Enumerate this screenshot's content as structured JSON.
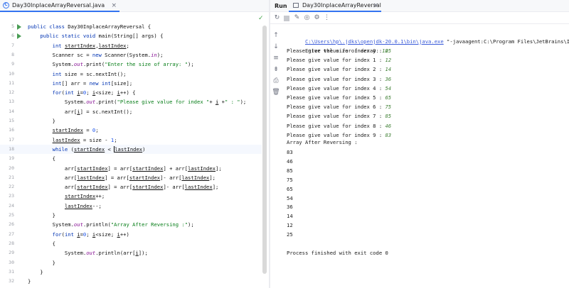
{
  "editor": {
    "tab_label": "Day30InplaceArrayReversal.java",
    "tab_close": "×",
    "check": "✓",
    "lines": [
      {
        "no": "5",
        "runnable": true,
        "html": "<span class=\"kw\">public class</span> Day30InplaceArrayReversal {"
      },
      {
        "no": "6",
        "runnable": true,
        "html": "    <span class=\"kw\">public static void</span> main(String[] args) {"
      },
      {
        "no": "7",
        "runnable": false,
        "html": "        <span class=\"kw\">int</span> <span class=\"ul\">startIndex</span>,<span class=\"ul\">lastIndex</span>;"
      },
      {
        "no": "8",
        "runnable": false,
        "html": "        Scanner sc = <span class=\"kw\">new</span> Scanner(System.<span class=\"st\">in</span>);"
      },
      {
        "no": "9",
        "runnable": false,
        "html": "        System.<span class=\"st\">out</span>.print(<span class=\"str\">\"Enter the size of array: \"</span>);"
      },
      {
        "no": "10",
        "runnable": false,
        "html": "        <span class=\"kw\">int</span> size = sc.nextInt();"
      },
      {
        "no": "11",
        "runnable": false,
        "html": "        <span class=\"kw\">int</span>[] arr = <span class=\"kw\">new int</span>[size];"
      },
      {
        "no": "12",
        "runnable": false,
        "html": "        <span class=\"kw\">for</span>(<span class=\"kw\">int</span> <span class=\"ul\">i</span>=<span class=\"num\">0</span>; <span class=\"ul\">i</span>&lt;size; <span class=\"ul\">i</span>++) {"
      },
      {
        "no": "13",
        "runnable": false,
        "html": "            System.<span class=\"st\">out</span>.print(<span class=\"str\">\"Please give value for index \"</span>+ <span class=\"ul\">i</span> +<span class=\"str\">\" : \"</span>);"
      },
      {
        "no": "14",
        "runnable": false,
        "html": "            arr[<span class=\"ul\">i</span>] = sc.nextInt();"
      },
      {
        "no": "15",
        "runnable": false,
        "html": "        }"
      },
      {
        "no": "16",
        "runnable": false,
        "html": "        <span class=\"ul\">startIndex</span> = <span class=\"num\">0</span>;"
      },
      {
        "no": "17",
        "runnable": false,
        "html": "        <span class=\"ul\">lastIndex</span> = size - <span class=\"num\">1</span>;"
      },
      {
        "no": "18",
        "runnable": false,
        "current": true,
        "html": "        <span class=\"kw\">while</span> (<span class=\"ul\">startIndex</span> &lt; <span class=\"ul cursor\">lastIndex</span>)"
      },
      {
        "no": "19",
        "runnable": false,
        "html": "        {"
      },
      {
        "no": "20",
        "runnable": false,
        "html": "            arr[<span class=\"ul\">startIndex</span>] = arr[<span class=\"ul\">startIndex</span>] + arr[<span class=\"ul\">lastIndex</span>];"
      },
      {
        "no": "21",
        "runnable": false,
        "html": "            arr[<span class=\"ul\">lastIndex</span>] = arr[<span class=\"ul\">startIndex</span>]- arr[<span class=\"ul\">lastIndex</span>];"
      },
      {
        "no": "22",
        "runnable": false,
        "html": "            arr[<span class=\"ul\">startIndex</span>] = arr[<span class=\"ul\">startIndex</span>]- arr[<span class=\"ul\">lastIndex</span>];"
      },
      {
        "no": "23",
        "runnable": false,
        "html": "            <span class=\"ul\">startIndex</span>++;"
      },
      {
        "no": "24",
        "runnable": false,
        "html": "            <span class=\"ul\">lastIndex</span>--;"
      },
      {
        "no": "25",
        "runnable": false,
        "html": "        }"
      },
      {
        "no": "26",
        "runnable": false,
        "html": "        System.<span class=\"st\">out</span>.println(<span class=\"str\">\"Array After Reversing :\"</span>);"
      },
      {
        "no": "27",
        "runnable": false,
        "html": "        <span class=\"kw\">for</span>(<span class=\"kw\">int</span> <span class=\"ul\">i</span>=<span class=\"num\">0</span>; <span class=\"ul\">i</span>&lt;size; <span class=\"ul\">i</span>++)"
      },
      {
        "no": "28",
        "runnable": false,
        "html": "        {"
      },
      {
        "no": "29",
        "runnable": false,
        "html": "            System.<span class=\"st\">out</span>.println(arr[<span class=\"ul\">i</span>]);"
      },
      {
        "no": "30",
        "runnable": false,
        "html": "        }"
      },
      {
        "no": "31",
        "runnable": false,
        "html": "    }"
      },
      {
        "no": "32",
        "runnable": false,
        "html": "}"
      },
      {
        "no": "33",
        "runnable": false,
        "html": ""
      }
    ]
  },
  "run": {
    "title": "Run",
    "tab_label": "Day30InplaceArrayReversal",
    "tab_close": "×",
    "toolbar_icons": [
      "rerun-icon",
      "stop-icon",
      "debug-icon",
      "camera-icon",
      "settings-icon",
      "more-icon"
    ],
    "toolbar_glyphs": [
      "↻",
      "",
      "✎",
      "◎",
      "⚙",
      "⋮"
    ],
    "side_glyphs": [
      "↑",
      "↓",
      "≡",
      "⇟",
      "⎙",
      "🗑"
    ],
    "side_names": [
      "scroll-up-icon",
      "scroll-down-icon",
      "soft-wrap-icon",
      "scroll-to-end-icon",
      "print-icon",
      "clear-icon"
    ],
    "command_path": "C:\\Users\\hp\\.jdks\\openjdk-20.0.1\\bin\\java.exe",
    "command_rest": " \"-javaagent:C:\\Program Files\\JetBrains\\Intelli",
    "size_prompt": "Enter the size of array: ",
    "size_value": "10",
    "index_prompts": [
      {
        "text": "Please give value for index 0 : ",
        "value": "25"
      },
      {
        "text": "Please give value for index 1 : ",
        "value": "12"
      },
      {
        "text": "Please give value for index 2 : ",
        "value": "14"
      },
      {
        "text": "Please give value for index 3 : ",
        "value": "36"
      },
      {
        "text": "Please give value for index 4 : ",
        "value": "54"
      },
      {
        "text": "Please give value for index 5 : ",
        "value": "65"
      },
      {
        "text": "Please give value for index 6 : ",
        "value": "75"
      },
      {
        "text": "Please give value for index 7 : ",
        "value": "85"
      },
      {
        "text": "Please give value for index 8 : ",
        "value": "46"
      },
      {
        "text": "Please give value for index 9 : ",
        "value": "83"
      }
    ],
    "after_label": "Array After Reversing :",
    "output_values": [
      "83",
      "46",
      "85",
      "75",
      "65",
      "54",
      "36",
      "14",
      "12",
      "25"
    ],
    "finished": "Process finished with exit code 0"
  }
}
